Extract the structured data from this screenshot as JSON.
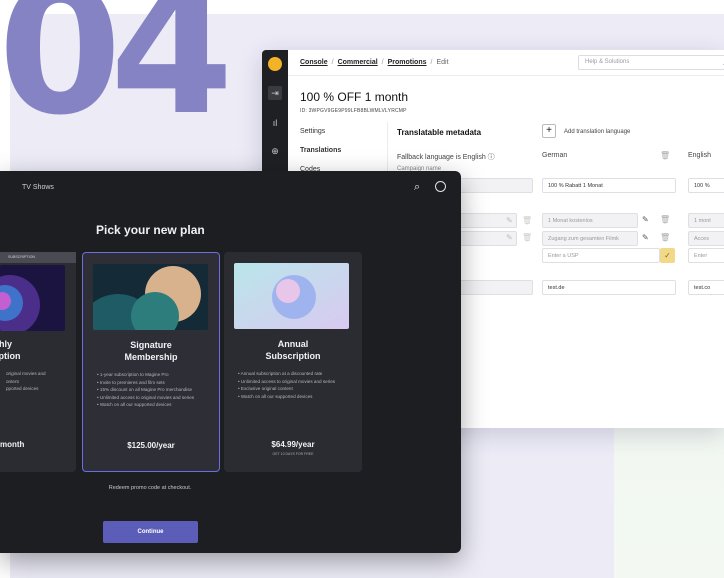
{
  "hero_number": "04",
  "console": {
    "breadcrumbs": [
      "Console",
      "Commercial",
      "Promotions",
      "Edit"
    ],
    "help_placeholder": "Help & Solutions",
    "title": "100 % OFF 1 month",
    "id": "ID: 3WPGV9GE9P99LFB8BLWMLVLYRCMP",
    "nav": [
      "Settings",
      "Translations",
      "Codes"
    ],
    "translatable_metadata": "Translatable metadata",
    "add_translation": "Add translation language",
    "fallback": "Fallback language is English",
    "col_german": "German",
    "col_english": "English",
    "campaign_name_label": "Campaign name",
    "fields_de": [
      "100 % Rabatt 1 Monat",
      "1 Monat kostenlos",
      "Zugang zum gesamten Filmk",
      "Enter a USP",
      "test.de"
    ],
    "fields_en": [
      "100 %",
      "1 mont",
      "Acces",
      "Enter",
      "test.co"
    ]
  },
  "plan": {
    "top_label": "TV Shows",
    "title": "Pick your new plan",
    "cards": [
      {
        "tag": "SUBSCRIPTION",
        "name_line1": "thly",
        "name_line2": "iption",
        "features": [
          "original movies and",
          "ontent",
          "pported devices"
        ],
        "price": "month"
      },
      {
        "name_line1": "Signature",
        "name_line2": "Membership",
        "features": [
          "1-year subscription to Magine Pro",
          "Invite to premieres and film sets",
          "15% discount on all Magine Pro merchandise",
          "Unlimited access to original movies and series",
          "Watch on all our supported devices"
        ],
        "price": "$125.00/year"
      },
      {
        "name_line1": "Annual",
        "name_line2": "Subscription",
        "features": [
          "Annual subscription at a discounted rate",
          "Unlimited access to original movies and series",
          "Exclusive original content",
          "Watch on all our supported devices"
        ],
        "price": "$64.99/year",
        "note": "GET 10 DAYS FOR FREE"
      }
    ],
    "redeem": "Redeem promo code at checkout.",
    "continue": "Continue"
  }
}
